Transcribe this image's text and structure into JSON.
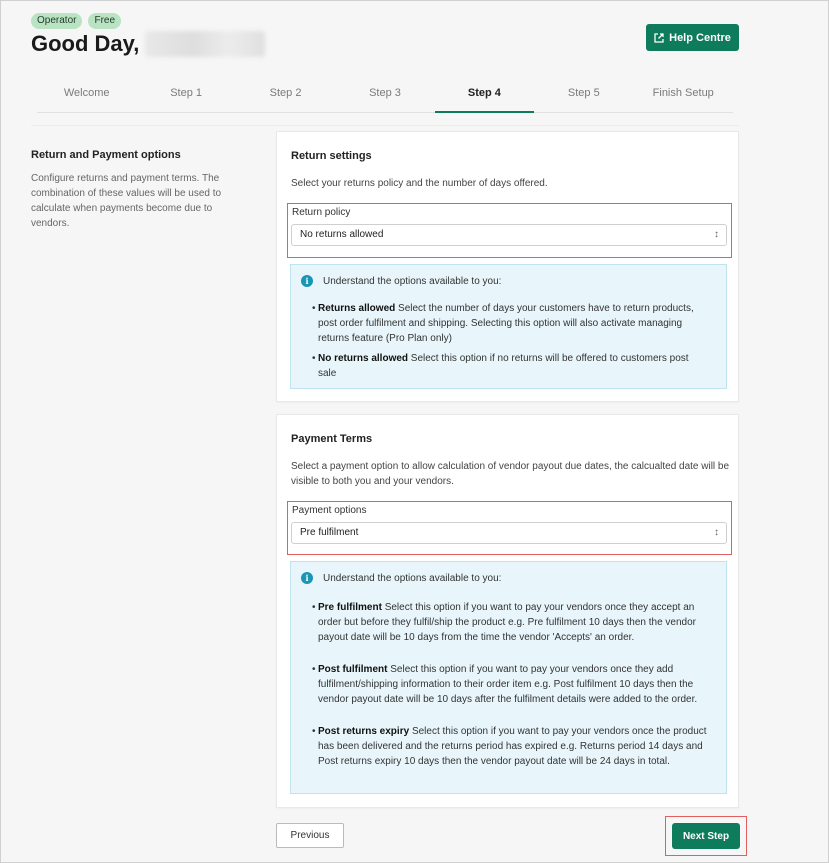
{
  "header": {
    "badges": [
      "Operator",
      "Free"
    ],
    "greeting": "Good Day,",
    "help_label": "Help Centre"
  },
  "tabs": [
    {
      "label": "Welcome"
    },
    {
      "label": "Step 1"
    },
    {
      "label": "Step 2"
    },
    {
      "label": "Step 3"
    },
    {
      "label": "Step 4"
    },
    {
      "label": "Step 5"
    },
    {
      "label": "Finish Setup"
    }
  ],
  "active_tab": "Step 4",
  "sidebar": {
    "title": "Return and Payment options",
    "description": "Configure returns and payment terms. The combination of these values will be used to calculate when payments become due to vendors."
  },
  "returns": {
    "title": "Return settings",
    "description": "Select your returns policy and the number of days offered.",
    "field_label": "Return policy",
    "selected": "No returns allowed",
    "info_title": "Understand the options available to you:",
    "options": [
      {
        "name": "Returns allowed",
        "text": "Select the number of days your customers have to return products, post order fulfilment and shipping. Selecting this option will also activate managing returns feature (Pro Plan only)"
      },
      {
        "name": "No returns allowed",
        "text": "Select this option if no returns will be offered to customers post sale"
      }
    ]
  },
  "payment": {
    "title": "Payment Terms",
    "description": "Select a payment option to allow calculation of vendor payout due dates, the calcualted date will be visible to both you and your vendors.",
    "field_label": "Payment options",
    "selected": "Pre fulfilment",
    "info_title": "Understand the options available to you:",
    "options": [
      {
        "name": "Pre fulfilment",
        "text": "Select this option if you want to pay your vendors once they accept an order but before they fulfil/ship the product e.g. Pre fulfilment 10 days then the vendor payout date will be 10 days from the time the vendor 'Accepts' an order."
      },
      {
        "name": "Post fulfilment",
        "text": "Select this option if you want to pay your vendors once they add fulfilment/shipping information to their order item e.g. Post fulfilment 10 days then the vendor payout date will be 10 days after the fulfilment details were added to the order."
      },
      {
        "name": "Post returns expiry",
        "text": "Select this option if you want to pay your vendors once the product has been delivered and the returns period has expired e.g. Returns period 14 days and Post returns expiry 10 days then the vendor payout date will be 24 days in total."
      }
    ]
  },
  "footer": {
    "previous_label": "Previous",
    "next_label": "Next Step"
  },
  "colors": {
    "brand": "#0f7b5d",
    "badge": "#b9e3c3",
    "highlight": "#e06060",
    "info_bg": "#e8f6fb",
    "info_icon": "#1a96b5"
  }
}
